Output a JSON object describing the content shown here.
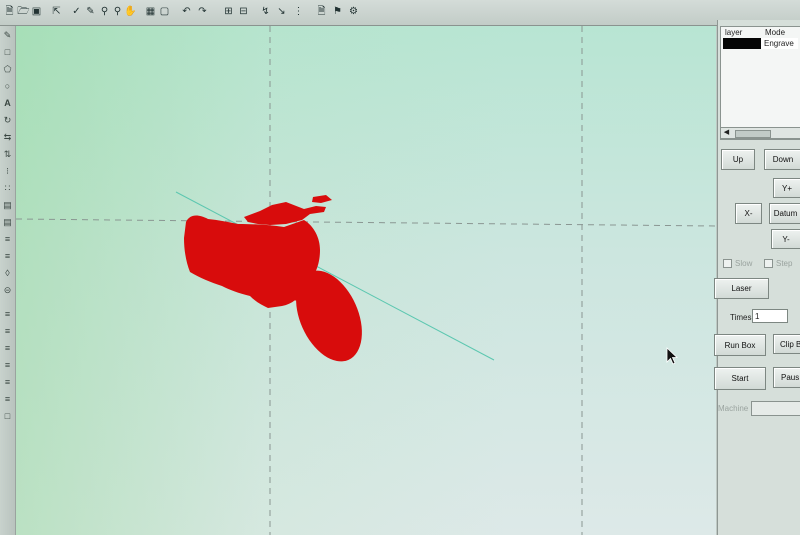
{
  "toolbar": {
    "icons": [
      "open-file-icon",
      "save-icon",
      "import-icon",
      "node-edit-icon",
      "zoom-in-icon",
      "zoom-out-icon",
      "pan-icon",
      "select-all-icon",
      "clear-icon",
      "undo-icon",
      "redo-icon",
      "group-icon",
      "ungroup-icon",
      "trace-icon",
      "arrow-icon",
      "array-icon",
      "print-preview-icon",
      "settings-icon",
      "stamp-icon"
    ]
  },
  "left_tools": {
    "text_tool_label": "A",
    "icons": [
      "pencil-icon",
      "rectangle-icon",
      "polygon-icon",
      "ellipse-icon",
      "text-icon",
      "rotate-icon",
      "mirror-icon",
      "distort-icon",
      "node-icon",
      "array-copy-icon",
      "align-icon",
      "distribute-icon",
      "weld-icon",
      "offset-icon",
      "measure-icon",
      "grid-icon",
      "layer-icon",
      "merge-icon",
      "hatch-icon",
      "cut-icon",
      "copy-icon",
      "paste-icon",
      "delete-icon"
    ]
  },
  "canvas": {
    "shape_color": "#d80c0c",
    "guide_color": "#5cc7b0"
  },
  "layers": {
    "headers": [
      "layer",
      "Mode"
    ],
    "rows": [
      {
        "color": "#050505",
        "mode": "Engrave"
      }
    ]
  },
  "controls": {
    "up": "Up",
    "down": "Down",
    "y_plus": "Y+",
    "x_minus": "X-",
    "datum": "Datum",
    "y_minus": "Y-",
    "slow": "Slow",
    "step": "Step",
    "laser": "Laser",
    "times_label": "Times",
    "times_value": "1",
    "run_box": "Run Box",
    "clip": "Clip B",
    "start": "Start",
    "pause": "Paus",
    "machine_label": "Machine"
  }
}
